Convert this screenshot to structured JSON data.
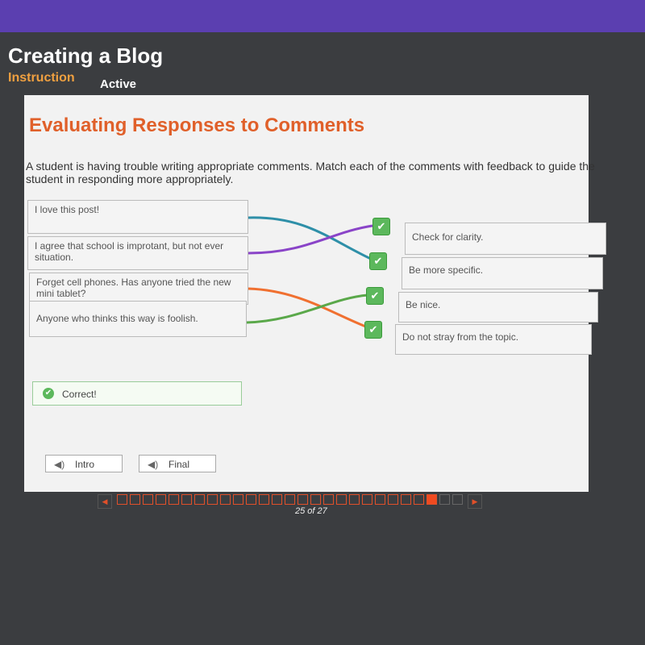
{
  "header": {
    "title": "Creating a Blog",
    "tabs": [
      "Instruction",
      "Active"
    ]
  },
  "activity": {
    "heading": "Evaluating Responses to Comments",
    "prompt": "A student is having trouble writing appropriate comments. Match each of the comments with feedback to guide the student in responding more appropriately.",
    "comments": [
      "I love this post!",
      "I agree that school is improtant, but not ever situation.",
      "Forget cell phones. Has anyone tried the new mini tablet?",
      "Anyone who thinks this way is foolish."
    ],
    "feedback": [
      "Check for clarity.",
      "Be more specific.",
      "Be nice.",
      "Do not stray from the topic."
    ],
    "line_colors": [
      "#2e8fa8",
      "#8a44c8",
      "#f07030",
      "#5aa84a"
    ],
    "status": "Correct!"
  },
  "footer": {
    "intro": "Intro",
    "final": "Final",
    "page_label": "25 of 27",
    "current": 25,
    "total": 27,
    "accent": "#f04a20"
  }
}
